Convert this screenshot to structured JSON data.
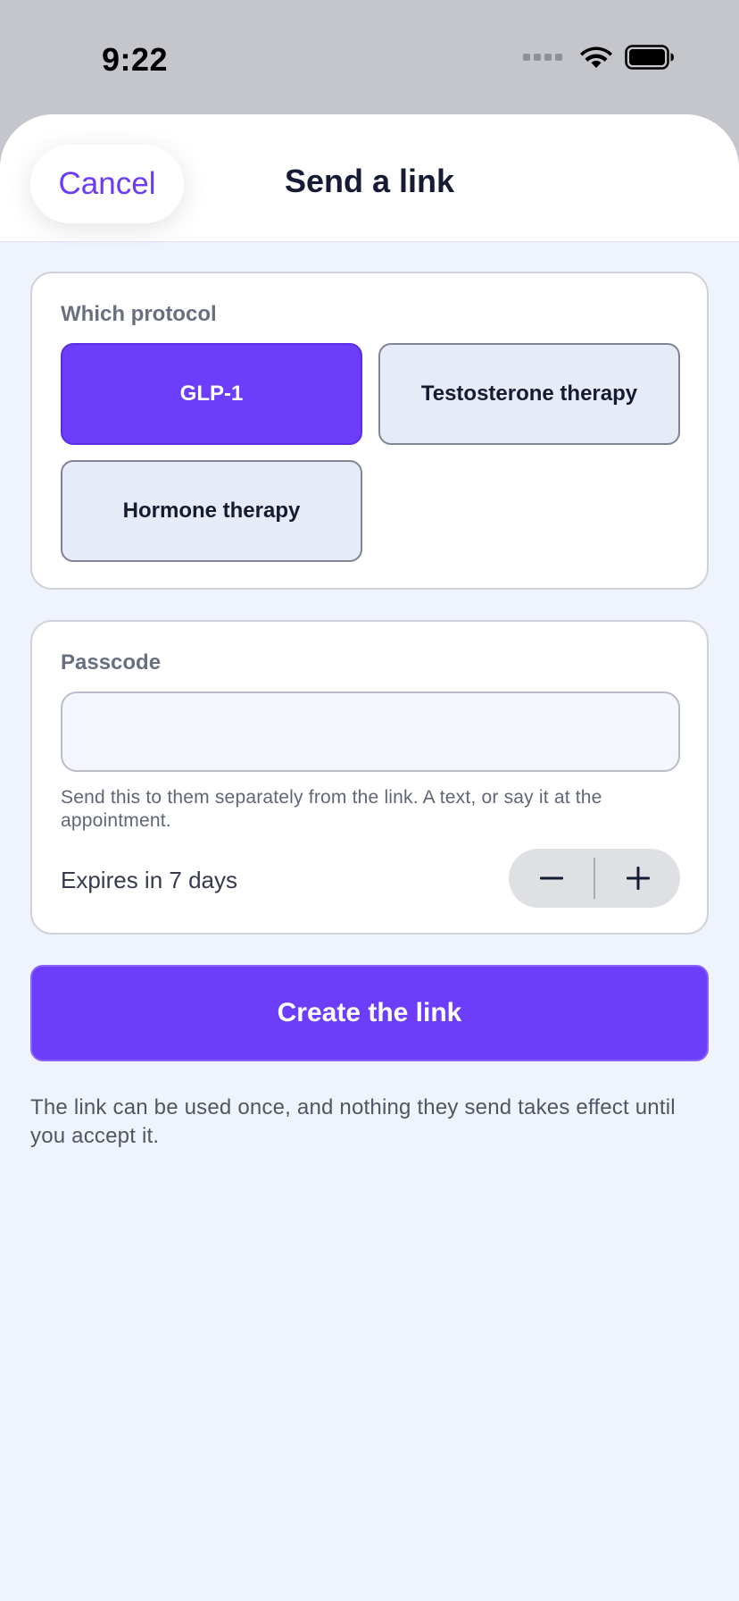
{
  "status_bar": {
    "time": "9:22"
  },
  "header": {
    "cancel_label": "Cancel",
    "title": "Send a link"
  },
  "protocol": {
    "label": "Which protocol",
    "options": [
      {
        "label": "GLP-1",
        "selected": true
      },
      {
        "label": "Testosterone therapy",
        "selected": false
      },
      {
        "label": "Hormone therapy",
        "selected": false
      }
    ]
  },
  "passcode": {
    "label": "Passcode",
    "value": "",
    "hint": "Send this to them separately from the link. A text, or say it at the appointment.",
    "expires_label": "Expires in 7 days"
  },
  "create_button_label": "Create the link",
  "footnote": "The link can be used once, and nothing they send takes effect until you accept it.",
  "colors": {
    "accent": "#6c3dfa",
    "background": "#eff3fc",
    "chip_unselected": "#e6ebf8"
  },
  "icons": {
    "signal": "cellular-signal-icon",
    "wifi": "wifi-icon",
    "battery": "battery-icon",
    "minus": "minus-icon",
    "plus": "plus-icon"
  }
}
